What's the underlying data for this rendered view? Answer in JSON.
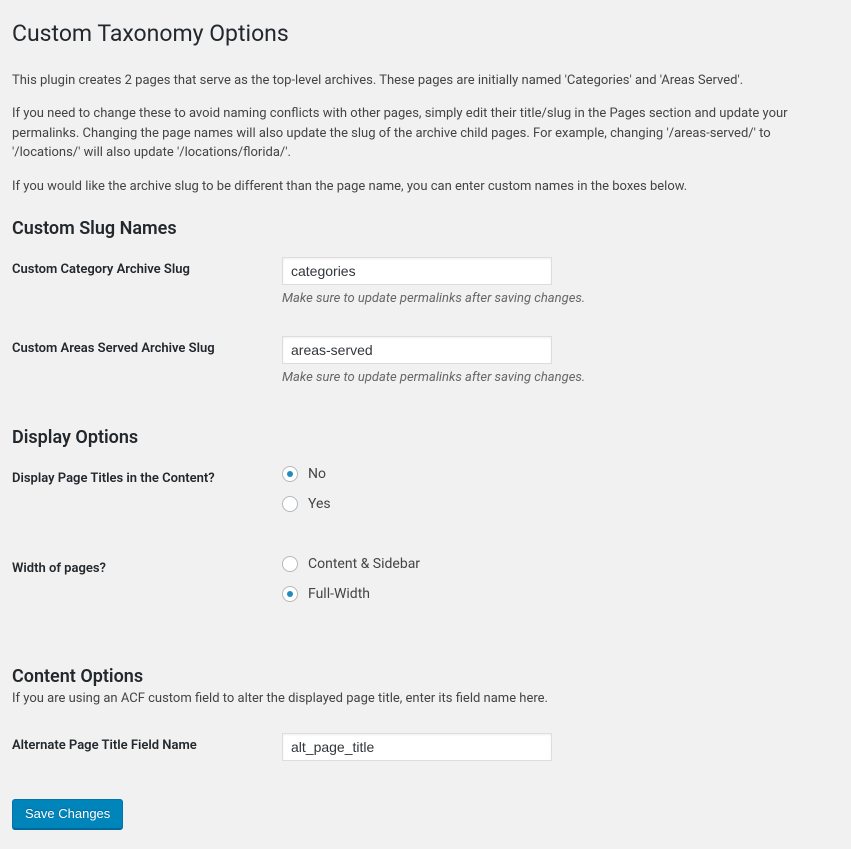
{
  "page": {
    "title": "Custom Taxonomy Options",
    "intro_p1": "This plugin creates 2 pages that serve as the top-level archives. These pages are initially named 'Categories' and 'Areas Served'.",
    "intro_p2": "If you need to change these to avoid naming conflicts with other pages, simply edit their title/slug in the Pages section and update your permalinks. Changing the page names will also update the slug of the archive child pages. For example, changing '/areas-served/' to '/locations/' will also update '/locations/florida/'.",
    "intro_p3": "If you would like the archive slug to be different than the page name, you can enter custom names in the boxes below."
  },
  "sections": {
    "slug_heading": "Custom Slug Names",
    "display_heading": "Display Options",
    "content_heading": "Content Options",
    "content_sub": "If you are using an ACF custom field to alter the displayed page title, enter its field name here."
  },
  "fields": {
    "category_slug": {
      "label": "Custom Category Archive Slug",
      "value": "categories",
      "desc": "Make sure to update permalinks after saving changes."
    },
    "areas_slug": {
      "label": "Custom Areas Served Archive Slug",
      "value": "areas-served",
      "desc": "Make sure to update permalinks after saving changes."
    },
    "display_titles": {
      "label": "Display Page Titles in the Content?",
      "option_no": "No",
      "option_yes": "Yes"
    },
    "page_width": {
      "label": "Width of pages?",
      "option_sidebar": "Content & Sidebar",
      "option_full": "Full-Width"
    },
    "alt_title": {
      "label": "Alternate Page Title Field Name",
      "value": "alt_page_title"
    }
  },
  "buttons": {
    "save": "Save Changes"
  }
}
